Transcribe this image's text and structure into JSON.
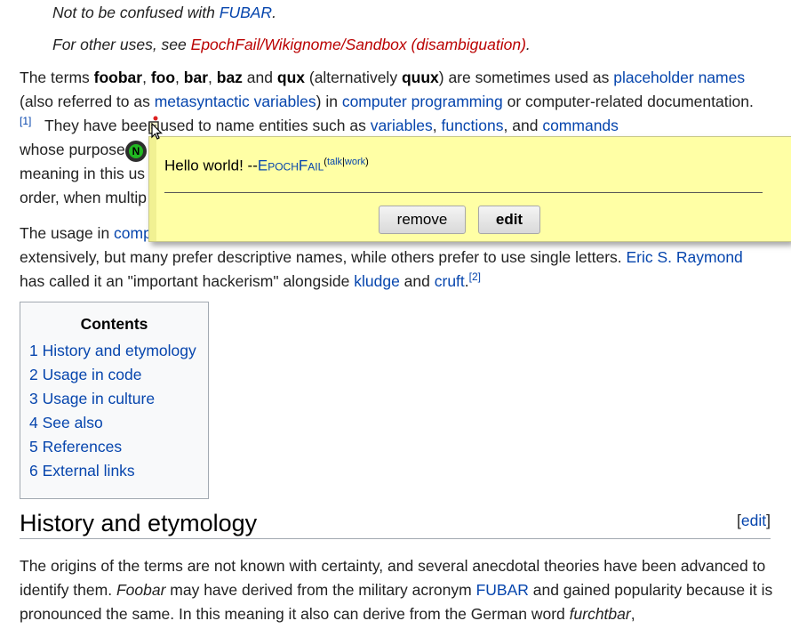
{
  "hatnotes": {
    "not_confused_prefix": "Not to be confused with ",
    "not_confused_link": "FUBAR",
    "not_confused_suffix": ".",
    "other_uses_prefix": "For other uses, see ",
    "other_uses_link": "EpochFail/Wikignome/Sandbox (disambiguation)",
    "other_uses_suffix": "."
  },
  "intro": {
    "t1": "The terms ",
    "b_foobar": "foobar",
    "t2": ", ",
    "b_foo": "foo",
    "t3": ", ",
    "b_bar": "bar",
    "t4": ", ",
    "b_baz": "baz",
    "t5": " and ",
    "b_qux": "qux",
    "t6": " (alternatively ",
    "b_quux": "quux",
    "t7": ") are sometimes used as ",
    "link_placeholder": "placeholder names",
    "t8": " (also referred to as ",
    "link_metasyntactic": "metasyntactic variables",
    "t9": ") in ",
    "link_programming": "computer programming",
    "t10": " or computer-related documentation.",
    "ref1": "[1]",
    "t11": "They have been used to name entities such as ",
    "link_variables": "variables",
    "t12": ", ",
    "link_functions": "functions",
    "t13": ", and ",
    "link_commands": "commands",
    "line5": "whose purpose",
    "line6": "meaning in this us",
    "line7": "order, when multip"
  },
  "usage": {
    "t1": "The usage in ",
    "link_comp": "comp",
    "line2": "extensively, but many prefer descriptive names, while others prefer to use single letters. ",
    "link_raymond": "Eric S. Raymond",
    "line3_a": "has called it an \"important hackerism\" alongside ",
    "link_kludge": "kludge",
    "line3_b": " and ",
    "link_cruft": "cruft",
    "line3_c": ".",
    "ref2": "[2]"
  },
  "toc": {
    "title": "Contents",
    "items": [
      {
        "num": "1",
        "label": "History and etymology"
      },
      {
        "num": "2",
        "label": "Usage in code"
      },
      {
        "num": "3",
        "label": "Usage in culture"
      },
      {
        "num": "4",
        "label": "See also"
      },
      {
        "num": "5",
        "label": "References"
      },
      {
        "num": "6",
        "label": "External links"
      }
    ]
  },
  "section": {
    "heading": "History and etymology",
    "edit_open": "[",
    "edit_label": "edit",
    "edit_close": "]"
  },
  "history_para": {
    "t1": "The origins of the terms are not known with certainty, and several anecdotal theories have been advanced to identify them. ",
    "i_foobar": "Foobar",
    "t2": " may have derived from the military acronym ",
    "link_fubar": "FUBAR",
    "t3": " and gained popularity because it is pronounced the same. In this meaning it also can derive from the German word ",
    "i_furchtbar": "furchtbar",
    "t4": ","
  },
  "popup": {
    "message": "Hello world! --",
    "user": "EpochFail",
    "talk": "talk",
    "pipe": "|",
    "work": "work",
    "remove_label": "remove",
    "edit_label": "edit",
    "badge_letter": "N"
  },
  "colors": {
    "link": "#0645ad",
    "redlink": "#ba0000",
    "popup_bg": "#ffffa5",
    "badge_green": "#21b921"
  }
}
